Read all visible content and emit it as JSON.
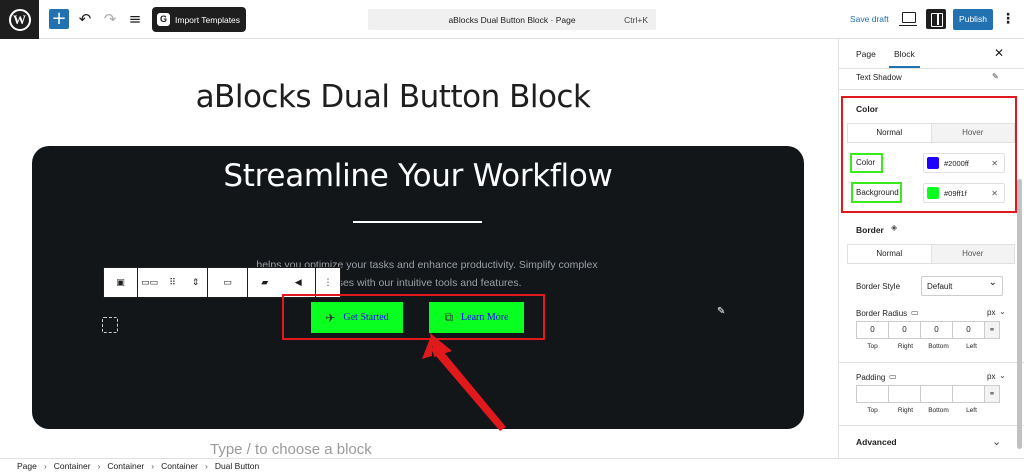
{
  "topbar": {
    "import_label": "Import Templates",
    "import_logo": "G",
    "command_title": "aBlocks Dual Button Block · Page",
    "command_shortcut": "Ctrl+K",
    "save_draft": "Save draft",
    "publish": "Publish",
    "icons": {
      "undo": "↶",
      "redo": "↷",
      "list_view": "≡",
      "add": "+",
      "more": "⋮"
    }
  },
  "canvas": {
    "page_title": "aBlocks Dual Button Block",
    "hero_title": "Streamline Your Workflow",
    "description_line1": "helps you optimize your tasks and enhance productivity. Simplify complex",
    "description_line2": "sses with our intuitive tools and features.",
    "button1_label": "Get Started",
    "button2_label": "Learn More",
    "placeholder": "Type / to choose a block",
    "button_text_color": "#2000ff",
    "button_bg_color": "#09ff1f"
  },
  "breadcrumb": [
    "Page",
    "Container",
    "Container",
    "Container",
    "Dual Button"
  ],
  "sidebar": {
    "tab_page": "Page",
    "tab_block": "Block",
    "text_shadow_label": "Text Shadow",
    "color_section": "Color",
    "color_tabs": {
      "normal": "Normal",
      "hover": "Hover"
    },
    "color_label": "Color",
    "color_value": "#2000ff",
    "background_label": "Background",
    "background_value": "#09ff1f",
    "border_section": "Border",
    "border_tabs": {
      "normal": "Normal",
      "hover": "Hover"
    },
    "border_style_label": "Border Style",
    "border_style_value": "Default",
    "border_radius_label": "Border Radius",
    "border_radius_unit": "px",
    "border_radius_values": [
      "0",
      "0",
      "0",
      "0"
    ],
    "side_labels": [
      "Top",
      "Right",
      "Bottom",
      "Left"
    ],
    "padding_label": "Padding",
    "padding_unit": "px",
    "advanced_label": "Advanced"
  }
}
